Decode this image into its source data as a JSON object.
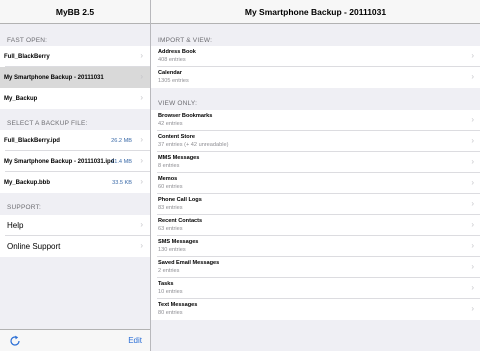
{
  "left": {
    "title": "MyBB 2.5",
    "fast_open_header": "FAST OPEN:",
    "fast_open": [
      {
        "label": "Full_BlackBerry",
        "selected": false
      },
      {
        "label": "My Smartphone Backup - 20111031",
        "selected": true
      },
      {
        "label": "My_Backup",
        "selected": false
      }
    ],
    "select_header": "SELECT A BACKUP FILE:",
    "files": [
      {
        "label": "Full_BlackBerry.ipd",
        "size": "26.2 MB"
      },
      {
        "label": "My Smartphone Backup - 20111031.ipd",
        "size": "21.4 MB"
      },
      {
        "label": "My_Backup.bbb",
        "size": "33.5 KB"
      }
    ],
    "support_header": "SUPPORT:",
    "support": [
      {
        "label": "Help"
      },
      {
        "label": "Online Support"
      }
    ],
    "toolbar": {
      "edit_label": "Edit",
      "refresh_icon": "refresh-icon"
    }
  },
  "right": {
    "title": "My Smartphone Backup - 20111031",
    "import_header": "IMPORT & VIEW:",
    "import_items": [
      {
        "title": "Address Book",
        "subtitle": "408 entries"
      },
      {
        "title": "Calendar",
        "subtitle": "1305 entries"
      }
    ],
    "view_header": "VIEW ONLY:",
    "view_items": [
      {
        "title": "Browser Bookmarks",
        "subtitle": "42 entries"
      },
      {
        "title": "Content Store",
        "subtitle": "37 entries (+ 42 unreadable)"
      },
      {
        "title": "MMS Messages",
        "subtitle": "8 entries"
      },
      {
        "title": "Memos",
        "subtitle": "60 entries"
      },
      {
        "title": "Phone Call Logs",
        "subtitle": "83 entries"
      },
      {
        "title": "Recent Contacts",
        "subtitle": "63 entries"
      },
      {
        "title": "SMS Messages",
        "subtitle": "130 entries"
      },
      {
        "title": "Saved Email Messages",
        "subtitle": "2 entries"
      },
      {
        "title": "Tasks",
        "subtitle": "10 entries"
      },
      {
        "title": "Text Messages",
        "subtitle": "80 entries"
      }
    ]
  },
  "colors": {
    "accent": "#2b6fd6",
    "size_text": "#3a6aa8",
    "selected_row": "#d9d9d9",
    "background": "#efeff4"
  }
}
